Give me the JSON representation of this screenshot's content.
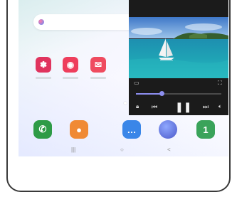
{
  "colors": {
    "gallery": "#e0345e",
    "camera": "#ee3e5c",
    "email": "#ef4b5f",
    "phone": "#2e9b46",
    "contacts": "#f08a35",
    "messages": "#3a86e8",
    "calendar": "#3aa35a",
    "accent": "#8d8ff0"
  },
  "home": {
    "apps": [
      {
        "name": "gallery",
        "icon": "flower-icon",
        "glyph": "✽"
      },
      {
        "name": "camera",
        "icon": "camera-icon",
        "glyph": "◉"
      },
      {
        "name": "email",
        "icon": "envelope-icon",
        "glyph": "✉"
      }
    ],
    "dock": [
      {
        "name": "phone",
        "icon": "phone-icon",
        "glyph": "✆"
      },
      {
        "name": "contacts",
        "icon": "person-icon",
        "glyph": "●"
      },
      {
        "name": "messages",
        "icon": "chat-icon",
        "glyph": "…"
      },
      {
        "name": "internet",
        "icon": "planet-icon",
        "glyph": ""
      },
      {
        "name": "calendar",
        "icon": "calendar-icon",
        "glyph": "1"
      }
    ]
  },
  "popup_player": {
    "progress": 0.3,
    "controls": [
      "minimize-icon",
      "fullscreen-icon",
      "lock-icon",
      "previous-icon",
      "pause-icon",
      "next-icon",
      "volume-icon"
    ]
  },
  "nav": {
    "recents_glyph": "|||",
    "home_glyph": "○",
    "back_glyph": "<"
  }
}
